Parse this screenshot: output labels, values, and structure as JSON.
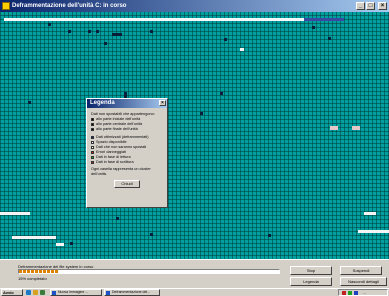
{
  "window": {
    "title": "Deframmentazione dell'unità C: in corso"
  },
  "legend": {
    "title": "Legenda",
    "close_glyph": "×",
    "section1_heading": "Dati non spostabili che appartengono:",
    "section1_items": [
      {
        "label": "allo parte iniziale dell'unità",
        "color": "#000000"
      },
      {
        "label": "allo parte centrale dell'unità",
        "color": "#000000"
      },
      {
        "label": "allo parte finale dell'unità",
        "color": "#000000"
      }
    ],
    "section2_items": [
      {
        "label": "Dati ottimizzati (deframmentati)",
        "color": "#0a2a8a"
      },
      {
        "label": "Spazio disponibile",
        "color": "#ffffff"
      },
      {
        "label": "Dati che non saranno spostati",
        "color": "#ffffff"
      },
      {
        "label": "Errori danneggiati",
        "color": "#e02020"
      },
      {
        "label": "Dati in fase di lettura",
        "color": "#20c020"
      },
      {
        "label": "Dati in fase di scrittura",
        "color": "#c02020"
      }
    ],
    "footer": "Ogni casella rappresenta un cluster dell'unità.",
    "close_button": "Chiudi"
  },
  "status": {
    "text": "Deframmentazione dei file system in corso",
    "percent_text": "15% completato",
    "progress_fraction": 0.15
  },
  "buttons": {
    "stop": "Stop",
    "pause": "Sospendi",
    "legend": "Legenda",
    "hide_details": "Nascondi dettagli"
  },
  "taskbar": {
    "start": "Avvio",
    "tasks": [
      "Nuova immagine ...",
      "Deframmentazione del..."
    ],
    "clock": "..."
  }
}
